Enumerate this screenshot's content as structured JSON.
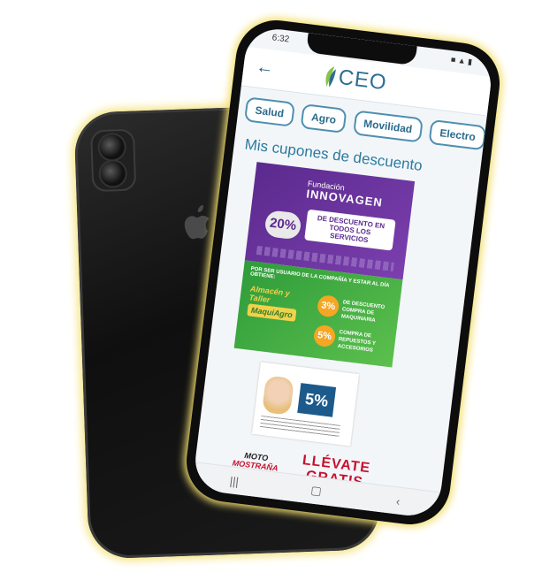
{
  "status_bar": {
    "time": "6:32",
    "icons": "■ ▲ ▮"
  },
  "header": {
    "back_icon": "←",
    "logo_text": "CEO"
  },
  "chips": [
    "Salud",
    "Agro",
    "Movilidad",
    "Electro"
  ],
  "section_title": "Mis cupones de descuento",
  "coupons": {
    "innovagen": {
      "brand_line": "Fundación",
      "brand_name": "INNOVAGEN",
      "percent": "20%",
      "description": "DE DESCUENTO EN TODOS LOS SERVICIOS"
    },
    "maquiagro": {
      "header": "POR SER USUARIO DE LA COMPAÑÍA Y ESTAR AL DÍA OBTIENE:",
      "store_name": "Almacén y Taller",
      "store_brand": "MaquiAgro",
      "offer1_percent": "3%",
      "offer1_text": "DE DESCUENTO COMPRA DE MAQUINARIA",
      "offer2_percent": "5%",
      "offer2_text": "COMPRA DE REPUESTOS Y ACCESORIOS"
    },
    "optical": {
      "percent": "5%"
    },
    "moto": {
      "line1": "MOTO",
      "line2": "MOSTRAÑA"
    },
    "llevate": {
      "line1": "LLÉVATE",
      "line2": "GRATIS"
    }
  },
  "navbar": {
    "recent": "|||",
    "home": "▢",
    "back": "‹"
  },
  "colors": {
    "accent": "#2c6f92",
    "glow": "#f3df70",
    "purple": "#5b2a8e",
    "green": "#2e9b3a"
  }
}
